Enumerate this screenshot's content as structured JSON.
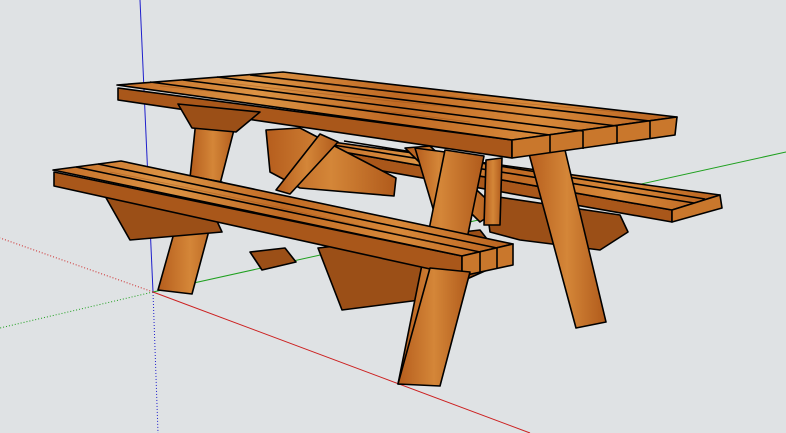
{
  "scene": {
    "model_name": "picnic-table",
    "background_color": "#dfe2e4",
    "axis_colors": {
      "red": "#cc1f1f",
      "green": "#1fa01f",
      "blue": "#1f1fcc"
    },
    "wood_colors": {
      "light": "#d8893a",
      "mid": "#c06a24",
      "dark": "#9b4f17"
    }
  }
}
